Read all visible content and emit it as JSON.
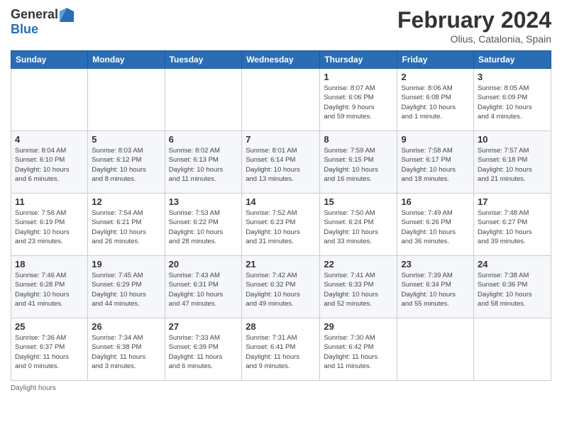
{
  "logo": {
    "general": "General",
    "blue": "Blue"
  },
  "title": "February 2024",
  "location": "Olius, Catalonia, Spain",
  "weekdays": [
    "Sunday",
    "Monday",
    "Tuesday",
    "Wednesday",
    "Thursday",
    "Friday",
    "Saturday"
  ],
  "weeks": [
    [
      {
        "day": "",
        "info": ""
      },
      {
        "day": "",
        "info": ""
      },
      {
        "day": "",
        "info": ""
      },
      {
        "day": "",
        "info": ""
      },
      {
        "day": "1",
        "info": "Sunrise: 8:07 AM\nSunset: 6:06 PM\nDaylight: 9 hours\nand 59 minutes."
      },
      {
        "day": "2",
        "info": "Sunrise: 8:06 AM\nSunset: 6:08 PM\nDaylight: 10 hours\nand 1 minute."
      },
      {
        "day": "3",
        "info": "Sunrise: 8:05 AM\nSunset: 6:09 PM\nDaylight: 10 hours\nand 4 minutes."
      }
    ],
    [
      {
        "day": "4",
        "info": "Sunrise: 8:04 AM\nSunset: 6:10 PM\nDaylight: 10 hours\nand 6 minutes."
      },
      {
        "day": "5",
        "info": "Sunrise: 8:03 AM\nSunset: 6:12 PM\nDaylight: 10 hours\nand 8 minutes."
      },
      {
        "day": "6",
        "info": "Sunrise: 8:02 AM\nSunset: 6:13 PM\nDaylight: 10 hours\nand 11 minutes."
      },
      {
        "day": "7",
        "info": "Sunrise: 8:01 AM\nSunset: 6:14 PM\nDaylight: 10 hours\nand 13 minutes."
      },
      {
        "day": "8",
        "info": "Sunrise: 7:59 AM\nSunset: 6:15 PM\nDaylight: 10 hours\nand 16 minutes."
      },
      {
        "day": "9",
        "info": "Sunrise: 7:58 AM\nSunset: 6:17 PM\nDaylight: 10 hours\nand 18 minutes."
      },
      {
        "day": "10",
        "info": "Sunrise: 7:57 AM\nSunset: 6:18 PM\nDaylight: 10 hours\nand 21 minutes."
      }
    ],
    [
      {
        "day": "11",
        "info": "Sunrise: 7:56 AM\nSunset: 6:19 PM\nDaylight: 10 hours\nand 23 minutes."
      },
      {
        "day": "12",
        "info": "Sunrise: 7:54 AM\nSunset: 6:21 PM\nDaylight: 10 hours\nand 26 minutes."
      },
      {
        "day": "13",
        "info": "Sunrise: 7:53 AM\nSunset: 6:22 PM\nDaylight: 10 hours\nand 28 minutes."
      },
      {
        "day": "14",
        "info": "Sunrise: 7:52 AM\nSunset: 6:23 PM\nDaylight: 10 hours\nand 31 minutes."
      },
      {
        "day": "15",
        "info": "Sunrise: 7:50 AM\nSunset: 6:24 PM\nDaylight: 10 hours\nand 33 minutes."
      },
      {
        "day": "16",
        "info": "Sunrise: 7:49 AM\nSunset: 6:26 PM\nDaylight: 10 hours\nand 36 minutes."
      },
      {
        "day": "17",
        "info": "Sunrise: 7:48 AM\nSunset: 6:27 PM\nDaylight: 10 hours\nand 39 minutes."
      }
    ],
    [
      {
        "day": "18",
        "info": "Sunrise: 7:46 AM\nSunset: 6:28 PM\nDaylight: 10 hours\nand 41 minutes."
      },
      {
        "day": "19",
        "info": "Sunrise: 7:45 AM\nSunset: 6:29 PM\nDaylight: 10 hours\nand 44 minutes."
      },
      {
        "day": "20",
        "info": "Sunrise: 7:43 AM\nSunset: 6:31 PM\nDaylight: 10 hours\nand 47 minutes."
      },
      {
        "day": "21",
        "info": "Sunrise: 7:42 AM\nSunset: 6:32 PM\nDaylight: 10 hours\nand 49 minutes."
      },
      {
        "day": "22",
        "info": "Sunrise: 7:41 AM\nSunset: 6:33 PM\nDaylight: 10 hours\nand 52 minutes."
      },
      {
        "day": "23",
        "info": "Sunrise: 7:39 AM\nSunset: 6:34 PM\nDaylight: 10 hours\nand 55 minutes."
      },
      {
        "day": "24",
        "info": "Sunrise: 7:38 AM\nSunset: 6:36 PM\nDaylight: 10 hours\nand 58 minutes."
      }
    ],
    [
      {
        "day": "25",
        "info": "Sunrise: 7:36 AM\nSunset: 6:37 PM\nDaylight: 11 hours\nand 0 minutes."
      },
      {
        "day": "26",
        "info": "Sunrise: 7:34 AM\nSunset: 6:38 PM\nDaylight: 11 hours\nand 3 minutes."
      },
      {
        "day": "27",
        "info": "Sunrise: 7:33 AM\nSunset: 6:39 PM\nDaylight: 11 hours\nand 6 minutes."
      },
      {
        "day": "28",
        "info": "Sunrise: 7:31 AM\nSunset: 6:41 PM\nDaylight: 11 hours\nand 9 minutes."
      },
      {
        "day": "29",
        "info": "Sunrise: 7:30 AM\nSunset: 6:42 PM\nDaylight: 11 hours\nand 11 minutes."
      },
      {
        "day": "",
        "info": ""
      },
      {
        "day": "",
        "info": ""
      }
    ]
  ],
  "footer": "Daylight hours"
}
